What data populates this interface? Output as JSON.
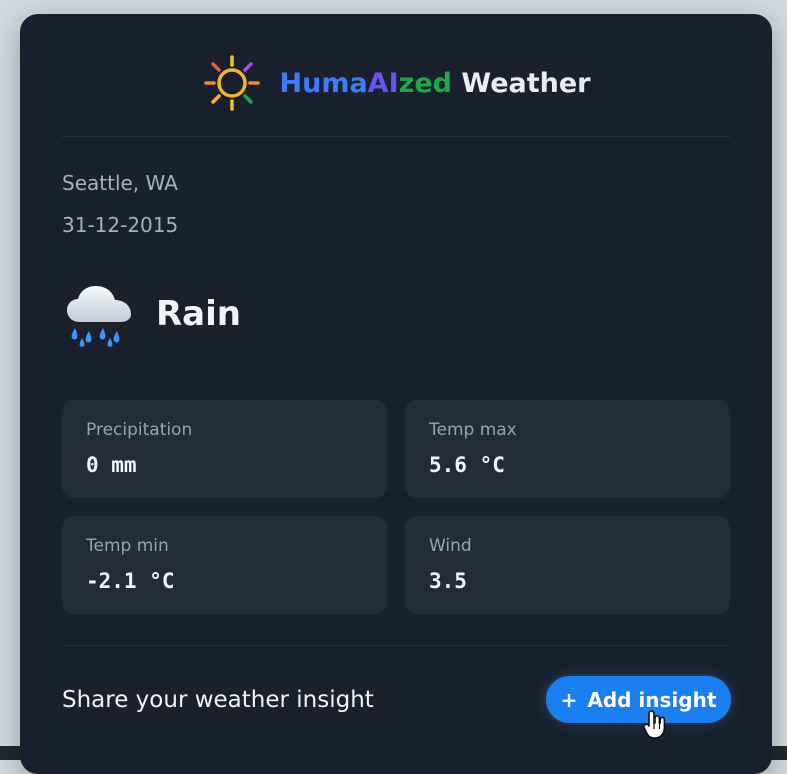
{
  "app": {
    "name_parts": [
      "Huma",
      "AI",
      "zed",
      " ",
      "Weather"
    ],
    "name_colors": {
      "part1": "#3f7cf7",
      "part2": "#6f51f1",
      "part3": "#1ea84a",
      "part4": "#e8edf3"
    },
    "logo_icon": "sun-icon"
  },
  "location": "Seattle, WA",
  "date": "31-12-2015",
  "condition": {
    "label": "Rain",
    "icon": "rain-cloud-icon"
  },
  "stats": [
    {
      "label": "Precipitation",
      "value": "0 mm"
    },
    {
      "label": "Temp max",
      "value": "5.6 °C"
    },
    {
      "label": "Temp min",
      "value": "-2.1 °C"
    },
    {
      "label": "Wind",
      "value": "3.5"
    }
  ],
  "insight": {
    "prompt": "Share your weather insight",
    "button_label": "Add insight",
    "button_icon": "plus-icon",
    "cursor_icon": "hand-pointer-icon"
  },
  "colors": {
    "background": "#d4d7dc",
    "card": "#1a212d",
    "panel": "#232b39",
    "accent": "#1a7ff0",
    "text_primary": "#f3f5f8",
    "text_secondary": "#98a3b3"
  }
}
